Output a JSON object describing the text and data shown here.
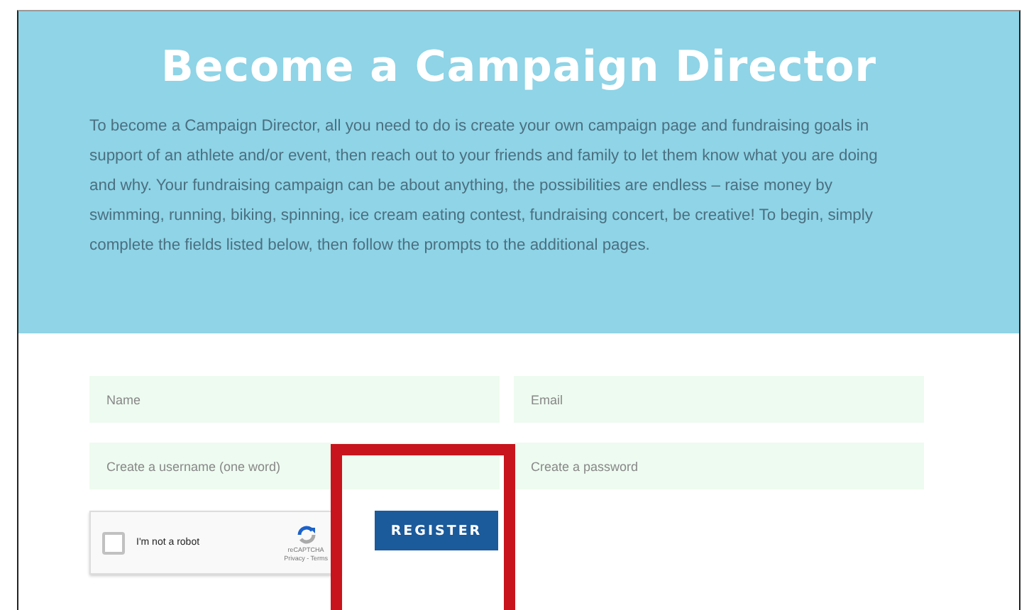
{
  "header": {
    "title": "Become a Campaign Director",
    "intro": "To become a Campaign Director, all you need to do is create your own campaign page and fundraising goals in support of an athlete and/or event, then reach out to your friends and family to let them know what you are doing and why. Your fundraising campaign can be about anything, the possibilities are endless – raise money by swimming, running, biking, spinning, ice cream eating contest, fundraising concert, be creative! To begin, simply complete the fields listed below, then follow the prompts to the additional pages."
  },
  "form": {
    "fields": [
      {
        "placeholder": "Name"
      },
      {
        "placeholder": "Email"
      },
      {
        "placeholder": "Create a username (one word)"
      },
      {
        "placeholder": "Create a password"
      }
    ],
    "captcha": {
      "label": "I'm not a robot",
      "checked": false,
      "brand": "reCAPTCHA",
      "links": "Privacy - Terms"
    },
    "submit": "REGISTER"
  },
  "highlight": {
    "shown": true
  }
}
